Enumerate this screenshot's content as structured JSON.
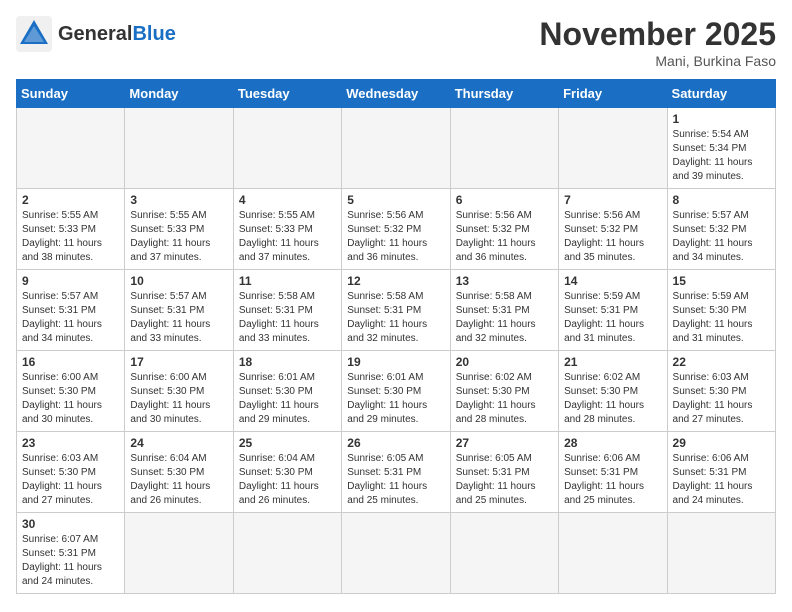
{
  "header": {
    "logo_general": "General",
    "logo_blue": "Blue",
    "month_title": "November 2025",
    "location": "Mani, Burkina Faso"
  },
  "days_of_week": [
    "Sunday",
    "Monday",
    "Tuesday",
    "Wednesday",
    "Thursday",
    "Friday",
    "Saturday"
  ],
  "weeks": [
    [
      {
        "day": "",
        "empty": true
      },
      {
        "day": "",
        "empty": true
      },
      {
        "day": "",
        "empty": true
      },
      {
        "day": "",
        "empty": true
      },
      {
        "day": "",
        "empty": true
      },
      {
        "day": "",
        "empty": true
      },
      {
        "day": "1",
        "sunrise": "Sunrise: 5:54 AM",
        "sunset": "Sunset: 5:34 PM",
        "daylight": "Daylight: 11 hours and 39 minutes."
      }
    ],
    [
      {
        "day": "2",
        "sunrise": "Sunrise: 5:55 AM",
        "sunset": "Sunset: 5:33 PM",
        "daylight": "Daylight: 11 hours and 38 minutes."
      },
      {
        "day": "3",
        "sunrise": "Sunrise: 5:55 AM",
        "sunset": "Sunset: 5:33 PM",
        "daylight": "Daylight: 11 hours and 37 minutes."
      },
      {
        "day": "4",
        "sunrise": "Sunrise: 5:55 AM",
        "sunset": "Sunset: 5:33 PM",
        "daylight": "Daylight: 11 hours and 37 minutes."
      },
      {
        "day": "5",
        "sunrise": "Sunrise: 5:56 AM",
        "sunset": "Sunset: 5:32 PM",
        "daylight": "Daylight: 11 hours and 36 minutes."
      },
      {
        "day": "6",
        "sunrise": "Sunrise: 5:56 AM",
        "sunset": "Sunset: 5:32 PM",
        "daylight": "Daylight: 11 hours and 36 minutes."
      },
      {
        "day": "7",
        "sunrise": "Sunrise: 5:56 AM",
        "sunset": "Sunset: 5:32 PM",
        "daylight": "Daylight: 11 hours and 35 minutes."
      },
      {
        "day": "8",
        "sunrise": "Sunrise: 5:57 AM",
        "sunset": "Sunset: 5:32 PM",
        "daylight": "Daylight: 11 hours and 34 minutes."
      }
    ],
    [
      {
        "day": "9",
        "sunrise": "Sunrise: 5:57 AM",
        "sunset": "Sunset: 5:31 PM",
        "daylight": "Daylight: 11 hours and 34 minutes."
      },
      {
        "day": "10",
        "sunrise": "Sunrise: 5:57 AM",
        "sunset": "Sunset: 5:31 PM",
        "daylight": "Daylight: 11 hours and 33 minutes."
      },
      {
        "day": "11",
        "sunrise": "Sunrise: 5:58 AM",
        "sunset": "Sunset: 5:31 PM",
        "daylight": "Daylight: 11 hours and 33 minutes."
      },
      {
        "day": "12",
        "sunrise": "Sunrise: 5:58 AM",
        "sunset": "Sunset: 5:31 PM",
        "daylight": "Daylight: 11 hours and 32 minutes."
      },
      {
        "day": "13",
        "sunrise": "Sunrise: 5:58 AM",
        "sunset": "Sunset: 5:31 PM",
        "daylight": "Daylight: 11 hours and 32 minutes."
      },
      {
        "day": "14",
        "sunrise": "Sunrise: 5:59 AM",
        "sunset": "Sunset: 5:31 PM",
        "daylight": "Daylight: 11 hours and 31 minutes."
      },
      {
        "day": "15",
        "sunrise": "Sunrise: 5:59 AM",
        "sunset": "Sunset: 5:30 PM",
        "daylight": "Daylight: 11 hours and 31 minutes."
      }
    ],
    [
      {
        "day": "16",
        "sunrise": "Sunrise: 6:00 AM",
        "sunset": "Sunset: 5:30 PM",
        "daylight": "Daylight: 11 hours and 30 minutes."
      },
      {
        "day": "17",
        "sunrise": "Sunrise: 6:00 AM",
        "sunset": "Sunset: 5:30 PM",
        "daylight": "Daylight: 11 hours and 30 minutes."
      },
      {
        "day": "18",
        "sunrise": "Sunrise: 6:01 AM",
        "sunset": "Sunset: 5:30 PM",
        "daylight": "Daylight: 11 hours and 29 minutes."
      },
      {
        "day": "19",
        "sunrise": "Sunrise: 6:01 AM",
        "sunset": "Sunset: 5:30 PM",
        "daylight": "Daylight: 11 hours and 29 minutes."
      },
      {
        "day": "20",
        "sunrise": "Sunrise: 6:02 AM",
        "sunset": "Sunset: 5:30 PM",
        "daylight": "Daylight: 11 hours and 28 minutes."
      },
      {
        "day": "21",
        "sunrise": "Sunrise: 6:02 AM",
        "sunset": "Sunset: 5:30 PM",
        "daylight": "Daylight: 11 hours and 28 minutes."
      },
      {
        "day": "22",
        "sunrise": "Sunrise: 6:03 AM",
        "sunset": "Sunset: 5:30 PM",
        "daylight": "Daylight: 11 hours and 27 minutes."
      }
    ],
    [
      {
        "day": "23",
        "sunrise": "Sunrise: 6:03 AM",
        "sunset": "Sunset: 5:30 PM",
        "daylight": "Daylight: 11 hours and 27 minutes."
      },
      {
        "day": "24",
        "sunrise": "Sunrise: 6:04 AM",
        "sunset": "Sunset: 5:30 PM",
        "daylight": "Daylight: 11 hours and 26 minutes."
      },
      {
        "day": "25",
        "sunrise": "Sunrise: 6:04 AM",
        "sunset": "Sunset: 5:30 PM",
        "daylight": "Daylight: 11 hours and 26 minutes."
      },
      {
        "day": "26",
        "sunrise": "Sunrise: 6:05 AM",
        "sunset": "Sunset: 5:31 PM",
        "daylight": "Daylight: 11 hours and 25 minutes."
      },
      {
        "day": "27",
        "sunrise": "Sunrise: 6:05 AM",
        "sunset": "Sunset: 5:31 PM",
        "daylight": "Daylight: 11 hours and 25 minutes."
      },
      {
        "day": "28",
        "sunrise": "Sunrise: 6:06 AM",
        "sunset": "Sunset: 5:31 PM",
        "daylight": "Daylight: 11 hours and 25 minutes."
      },
      {
        "day": "29",
        "sunrise": "Sunrise: 6:06 AM",
        "sunset": "Sunset: 5:31 PM",
        "daylight": "Daylight: 11 hours and 24 minutes."
      }
    ],
    [
      {
        "day": "30",
        "sunrise": "Sunrise: 6:07 AM",
        "sunset": "Sunset: 5:31 PM",
        "daylight": "Daylight: 11 hours and 24 minutes."
      },
      {
        "day": "",
        "empty": true
      },
      {
        "day": "",
        "empty": true
      },
      {
        "day": "",
        "empty": true
      },
      {
        "day": "",
        "empty": true
      },
      {
        "day": "",
        "empty": true
      },
      {
        "day": "",
        "empty": true
      }
    ]
  ]
}
